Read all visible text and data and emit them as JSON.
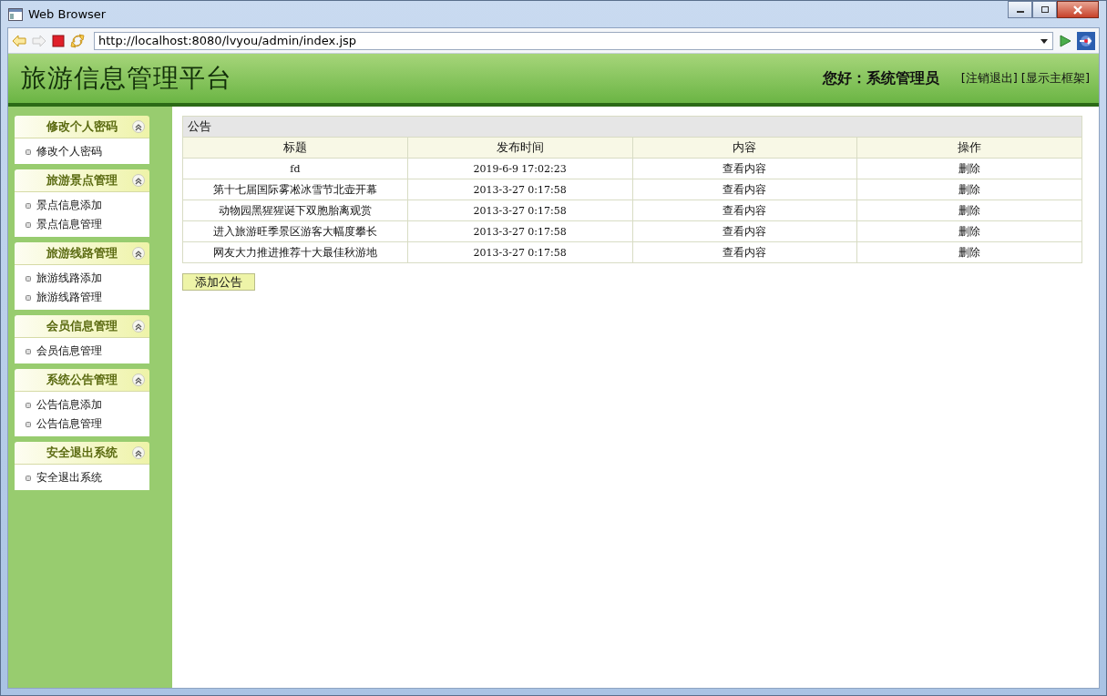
{
  "window": {
    "title": "Web Browser"
  },
  "address_bar": {
    "value": "http://localhost:8080/lvyou/admin/index.jsp"
  },
  "header": {
    "title": "旅游信息管理平台",
    "greeting": "您好：系统管理员",
    "links": [
      "[注销退出]",
      "[显示主框架]"
    ]
  },
  "sidebar": {
    "groups": [
      {
        "title": "修改个人密码",
        "expanded": true,
        "items": [
          "修改个人密码"
        ]
      },
      {
        "title": "旅游景点管理",
        "expanded": true,
        "items": [
          "景点信息添加",
          "景点信息管理"
        ]
      },
      {
        "title": "旅游线路管理",
        "expanded": true,
        "items": [
          "旅游线路添加",
          "旅游线路管理"
        ]
      },
      {
        "title": "会员信息管理",
        "expanded": true,
        "items": [
          "会员信息管理"
        ]
      },
      {
        "title": "系统公告管理",
        "expanded": true,
        "items": [
          "公告信息添加",
          "公告信息管理"
        ]
      },
      {
        "title": "安全退出系统",
        "expanded": true,
        "items": [
          "安全退出系统"
        ]
      }
    ]
  },
  "panel": {
    "title": "公告",
    "table": {
      "columns": [
        "标题",
        "发布时间",
        "内容",
        "操作"
      ],
      "rows": [
        [
          "fd",
          "2019-6-9 17:02:23",
          "查看内容",
          "删除"
        ],
        [
          "第十七届国际雾凇冰雪节北壶开幕",
          "2013-3-27 0:17:58",
          "查看内容",
          "删除"
        ],
        [
          "动物园黑猩猩诞下双胞胎离观赏",
          "2013-3-27 0:17:58",
          "查看内容",
          "删除"
        ],
        [
          "进入旅游旺季景区游客大幅度攀长",
          "2013-3-27 0:17:58",
          "查看内容",
          "删除"
        ],
        [
          "网友大力推进推荐十大最佳秋游地",
          "2013-3-27 0:17:58",
          "查看内容",
          "删除"
        ]
      ]
    },
    "add_button": "添加公告"
  }
}
